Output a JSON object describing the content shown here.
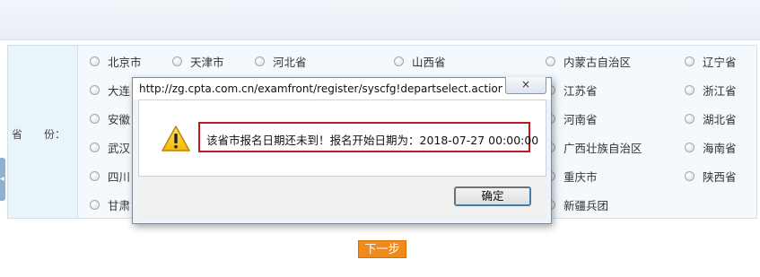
{
  "form": {
    "province_label": "省　　份：",
    "provinces": [
      "北京市",
      "天津市",
      "河北省",
      "山西省",
      "内蒙古自治区",
      "辽宁省",
      "大连",
      "江苏省",
      "浙江省",
      "安徽",
      "河南省",
      "湖北省",
      "武汉",
      "广西壮族自治区",
      "海南省",
      "四川",
      "重庆市",
      "陕西省",
      "甘肃",
      "新疆兵团"
    ]
  },
  "next_button": "下一步",
  "dialog": {
    "title": "http://zg.cpta.com.cn/examfront/register/syscfg!departselect.action?...",
    "close_label": "×",
    "message": "该省市报名日期还未到！报名开始日期为：2018-07-27 00:00:00",
    "ok_label": "确定"
  }
}
